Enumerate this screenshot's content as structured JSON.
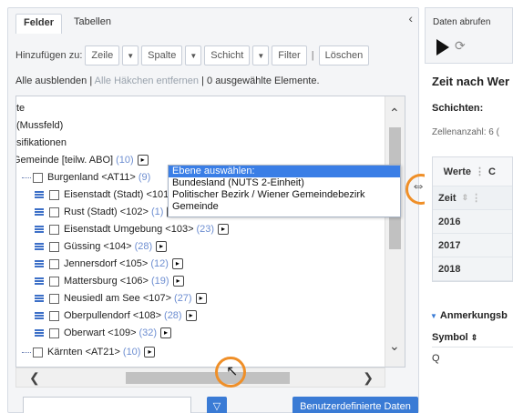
{
  "left": {
    "tabs": [
      "Felder",
      "Tabellen"
    ],
    "toolbar": {
      "add_to_label": "Hinzufügen zu:",
      "row_label": "Zeile",
      "column_label": "Spalte",
      "layer_label": "Schicht",
      "filter_label": "Filter",
      "separator": "|",
      "delete_label": "Löschen"
    },
    "status": {
      "hide_all": "Alle ausblenden",
      "sep1": " | ",
      "remove_checks": "Alle Häkchen entfernen",
      "sep2": " | ",
      "selected_count": "0 ausgewählte Elemente."
    },
    "tree": [
      {
        "label": "te"
      },
      {
        "label": "(Mussfeld)"
      },
      {
        "label": "sifikationen"
      },
      {
        "label": "Gemeinde [teilw. ABO]",
        "count": "(10)"
      },
      {
        "label": "Burgenland <AT11>",
        "count": "(9)"
      },
      {
        "label": "Eisenstadt (Stadt) <101>"
      },
      {
        "label": "Rust (Stadt) <102>",
        "count": "(1)"
      },
      {
        "label": "Eisenstadt Umgebung <103>",
        "count": "(23)"
      },
      {
        "label": "Güssing <104>",
        "count": "(28)"
      },
      {
        "label": "Jennersdorf <105>",
        "count": "(12)"
      },
      {
        "label": "Mattersburg <106>",
        "count": "(19)"
      },
      {
        "label": "Neusiedl am See <107>",
        "count": "(27)"
      },
      {
        "label": "Oberpullendorf <108>",
        "count": "(28)"
      },
      {
        "label": "Oberwart <109>",
        "count": "(32)"
      },
      {
        "label": "Kärnten <AT21>",
        "count": "(10)"
      }
    ],
    "popup": {
      "title": "Ebene auswählen:",
      "options": [
        "Bundesland (NUTS 2-Einheit)",
        "Politischer Bezirk / Wiener Gemeindebezirk",
        "Gemeinde"
      ]
    },
    "search_value": "",
    "custom_button": "Benutzerdefinierte Daten"
  },
  "right": {
    "fetch_label": "Daten abrufen",
    "title": "Zeit nach Wer",
    "schichten": "Schichten:",
    "zellen": "Zellenanzahl: 6 (",
    "table_head": "Werte",
    "table_head2": "C",
    "zeit": "Zeit",
    "years": [
      "2016",
      "2017",
      "2018"
    ],
    "anmerkungen": "Anmerkungsb",
    "symbol": "Symbol",
    "q": "Q"
  },
  "colors": {
    "accent": "#3a7bd5",
    "highlight": "#ef8f28",
    "count": "#6d8ed1"
  }
}
